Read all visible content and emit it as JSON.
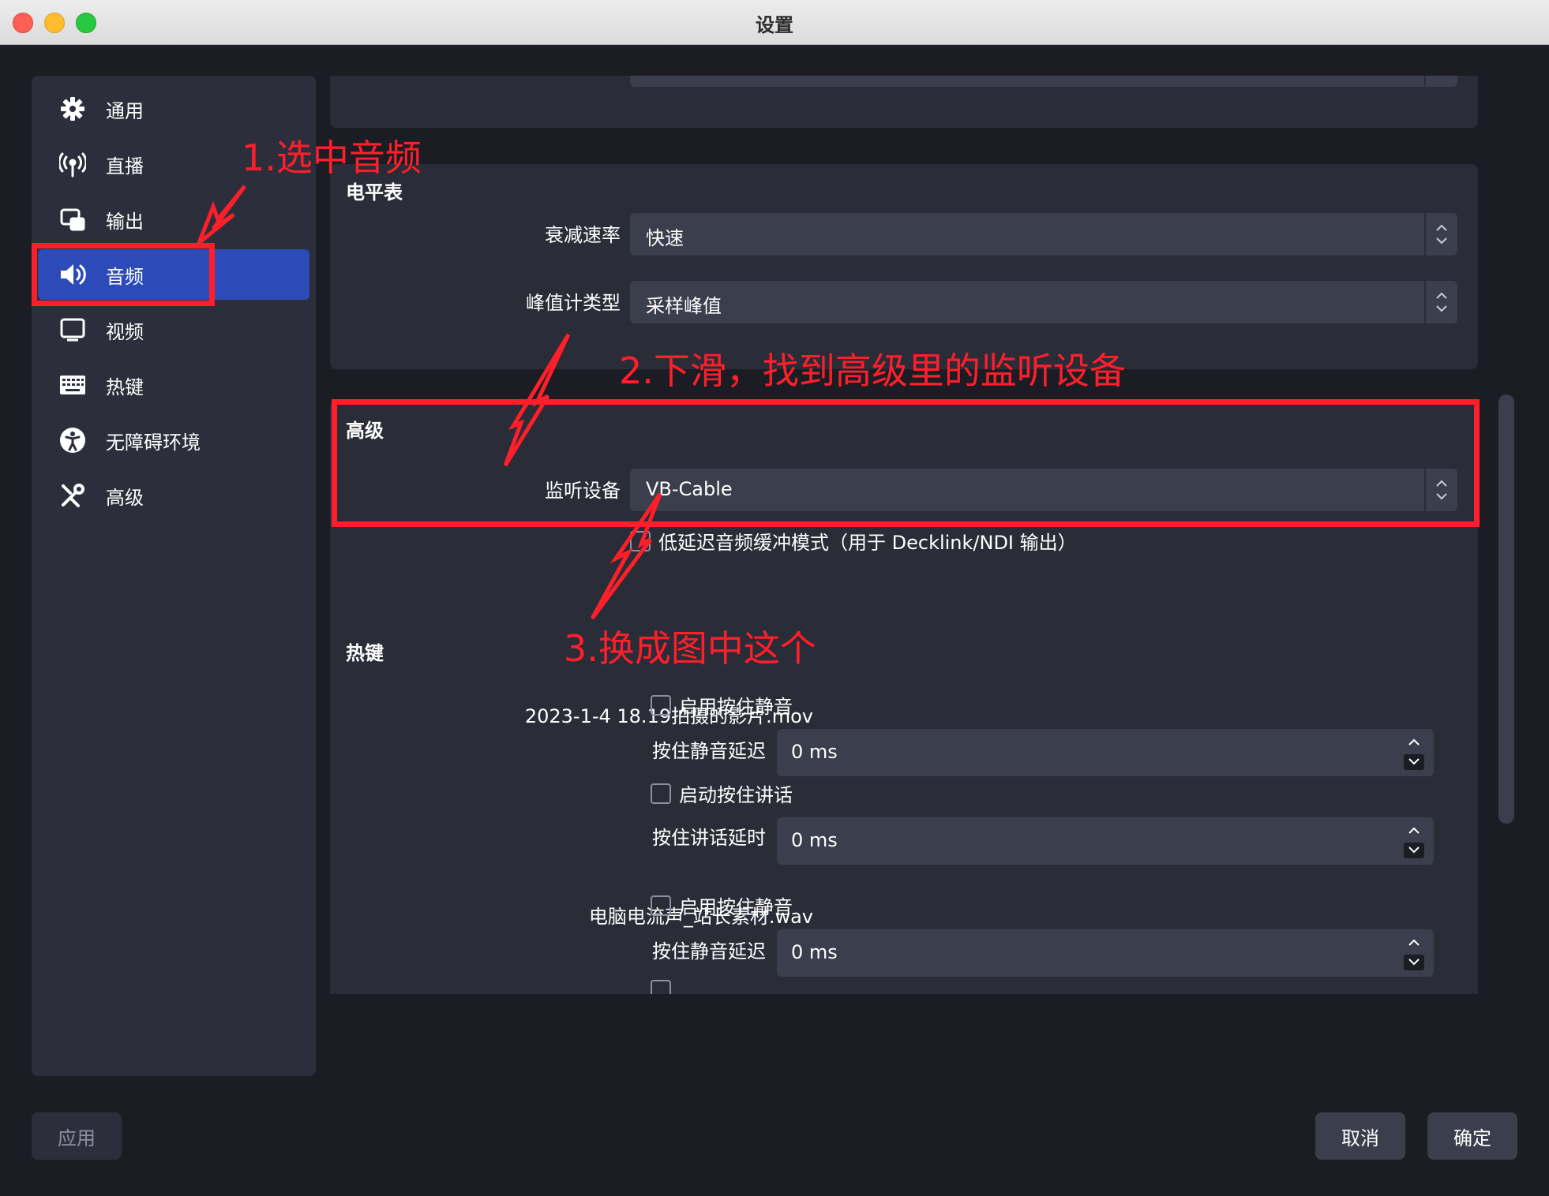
{
  "window": {
    "title": "设置"
  },
  "sidebar": {
    "items": [
      {
        "label": "通用",
        "icon": "gear-icon"
      },
      {
        "label": "直播",
        "icon": "antenna-icon"
      },
      {
        "label": "输出",
        "icon": "output-icon"
      },
      {
        "label": "音频",
        "icon": "speaker-icon",
        "active": true
      },
      {
        "label": "视频",
        "icon": "monitor-icon"
      },
      {
        "label": "热键",
        "icon": "keyboard-icon"
      },
      {
        "label": "无障碍环境",
        "icon": "accessibility-icon"
      },
      {
        "label": "高级",
        "icon": "tools-icon"
      }
    ]
  },
  "meters": {
    "title": "电平表",
    "decay_label": "衰减速率",
    "decay_value": "快速",
    "peak_label": "峰值计类型",
    "peak_value": "采样峰值"
  },
  "advanced": {
    "title": "高级",
    "monitor_label": "监听设备",
    "monitor_value": "VB-Cable",
    "low_latency_label": "低延迟音频缓冲模式（用于 Decklink/NDI 输出）"
  },
  "hotkeys": {
    "title": "热键",
    "sources": [
      {
        "name": "2023-1-4 18.19拍摄的影片.mov",
        "mute_check": "启用按住静音",
        "mute_delay_label": "按住静音延迟",
        "mute_delay_value": "0 ms",
        "talk_check": "启动按住讲话",
        "talk_delay_label": "按住讲话延时",
        "talk_delay_value": "0 ms"
      },
      {
        "name": "电脑电流声_站长素材.wav",
        "mute_check": "启用按住静音",
        "mute_delay_label": "按住静音延迟",
        "mute_delay_value": "0 ms"
      }
    ]
  },
  "footer": {
    "apply": "应用",
    "cancel": "取消",
    "ok": "确定"
  },
  "annotations": {
    "step1": "1.选中音频",
    "step2": "2.下滑，找到高级里的监听设备",
    "step3": "3.换成图中这个",
    "color": "#ff1f2a"
  },
  "colors": {
    "accent": "#2c4bb8",
    "background": "#1c1d24",
    "panel": "#2a2c37"
  }
}
